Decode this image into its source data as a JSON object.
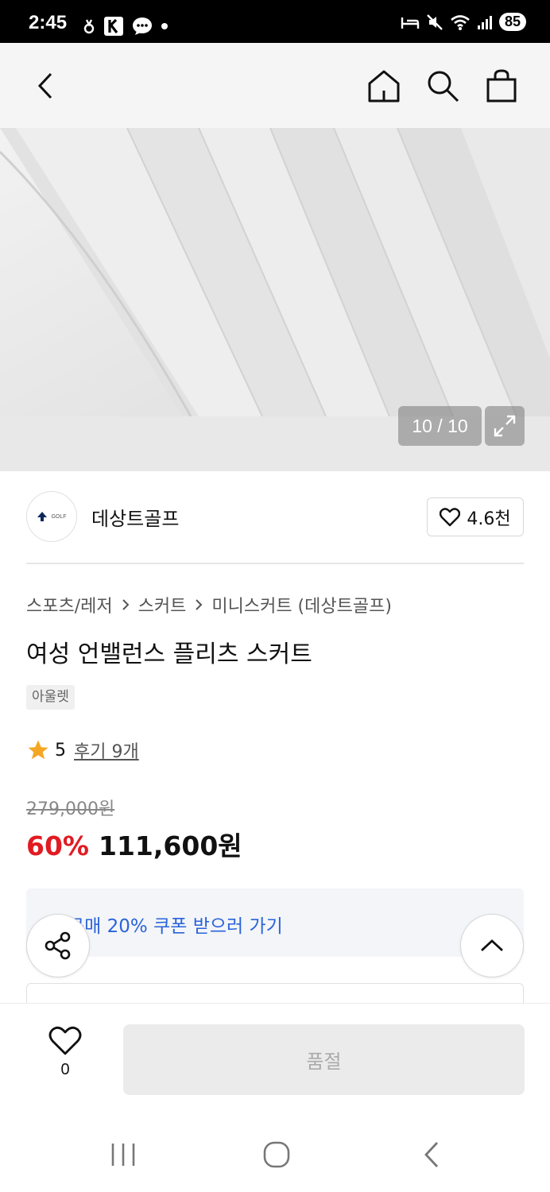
{
  "status_bar": {
    "time": "2:45",
    "battery": "85"
  },
  "gallery": {
    "counter": "10 / 10"
  },
  "brand": {
    "name": "데상트골프",
    "logo_text": "GOLF",
    "likes": "4.6천"
  },
  "breadcrumb": [
    "스포츠/레저",
    "스커트",
    "미니스커트 (데상트골프)"
  ],
  "product": {
    "title": "여성 언밸런스 플리츠 스커트",
    "badge": "아울렛",
    "rating": "5",
    "reviews": "후기 9개",
    "original_price": "279,000원",
    "discount": "60%",
    "sale_price": "111,600원"
  },
  "coupon": {
    "text": "구매 20% 쿠폰 받으러 가기"
  },
  "buy_bar": {
    "wish_count": "0",
    "buy_label": "품절"
  },
  "colors": {
    "discount": "#e11b22",
    "coupon_link": "#2a63d9",
    "star": "#f5a623"
  }
}
